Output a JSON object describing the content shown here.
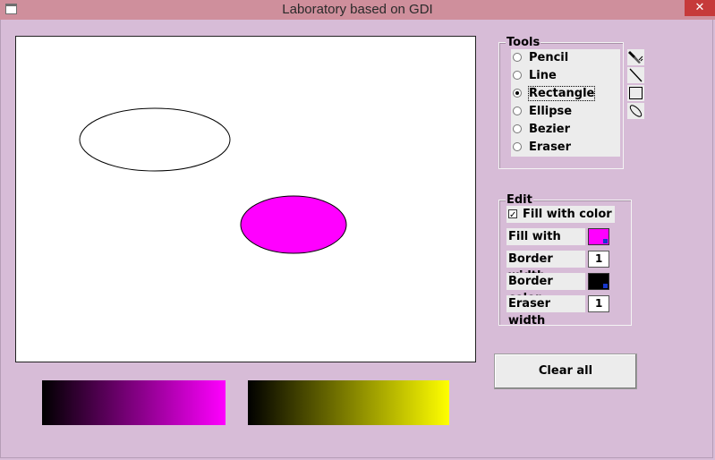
{
  "window": {
    "title": "Laboratory based on GDI",
    "close_glyph": "✕"
  },
  "tools": {
    "legend": "Tools",
    "items": [
      {
        "label": "Pencil",
        "checked": false,
        "icon": "pencil-icon"
      },
      {
        "label": "Line",
        "checked": false,
        "icon": "line-icon"
      },
      {
        "label": "Rectangle",
        "checked": true,
        "icon": "rectangle-icon"
      },
      {
        "label": "Ellipse",
        "checked": false,
        "icon": "ellipse-icon"
      },
      {
        "label": "Bezier",
        "checked": false
      },
      {
        "label": "Eraser",
        "checked": false
      }
    ]
  },
  "edit": {
    "legend": "Edit",
    "fill_with_color_label": "Fill with color",
    "fill_with_color_checked": true,
    "fill_with_label": "Fill with",
    "fill_color": "#ff00ff",
    "border_width_label": "Border width",
    "border_width": "1",
    "border_color_label": "Border color",
    "border_color": "#000000",
    "eraser_width_label": "Eraser width",
    "eraser_width": "1"
  },
  "buttons": {
    "clear_all": "Clear all"
  },
  "colors": {
    "background": "#d7bcd7",
    "titlebar": "#cf8f9c",
    "fill_gradient_end": "#ff00ff",
    "border_gradient_end": "#ffff00"
  }
}
